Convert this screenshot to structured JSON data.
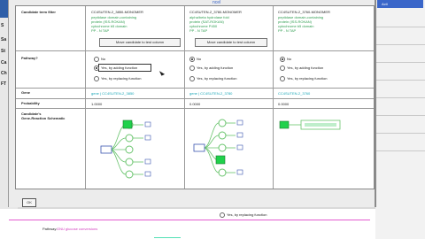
{
  "left_strip": [
    "S",
    "Sa",
    "St",
    "Ca",
    "Ch",
    "FT"
  ],
  "right_pane": {
    "header": "Acti"
  },
  "window": {
    "title_fragment": "ncel",
    "rows": {
      "filter_header": "Candidate term filter",
      "pathway_header": "Pathway?",
      "gene_header": "Gene",
      "probability_header": "Probability",
      "schematic_header_1": "Candidate's",
      "schematic_header_2": "Gene-Reaction Schematic"
    },
    "columns": [
      {
        "monomer": "CC4SUTEN-2_3850-MONOMER",
        "desc": [
          "peptidase domain-containing",
          "protein (ISS-ROKAN)",
          "cytochrome b5 domain",
          "PP - N TAP"
        ],
        "move_button": "Move candidate to test column",
        "radio": [
          "No",
          "Yes, by adding function",
          "Yes, by replacing function"
        ],
        "selected": 1,
        "gene": "gene | CC4SUTEN-2_3850",
        "probability": "1.0000"
      },
      {
        "monomer": "CC4SUTEN-2_3780-MONOMER",
        "desc": [
          "alpha/beta hydrolase fold",
          "protein (SAT-ROKAN)",
          "cytochrome P450",
          "PP - N TAP"
        ],
        "move_button": "Move candidate to test column",
        "radio": [
          "No",
          "Yes, by adding function",
          "Yes, by replacing function"
        ],
        "selected": 0,
        "gene": "gene | CC4SUTEN-2_3780",
        "probability": "0.0000"
      },
      {
        "monomer": "CC4SUTEN-2_3760-MONOMER",
        "desc": [
          "peptidase domain-containing",
          "protein (ISS-ROKAN)",
          "cytochrome b5 domain",
          "PP - N TAP"
        ],
        "move_button": "",
        "radio": [
          "No",
          "Yes, by adding function",
          "Yes, by replacing function"
        ],
        "selected": 0,
        "gene": "CC4SUTEN-2_3760",
        "probability": "0.0000"
      }
    ],
    "ok_label": "OK"
  },
  "background": {
    "radio_label": "Yes, by replacing function",
    "pathway_prefix": "Pathway:",
    "pathway_link": "GNU glucose conversions"
  },
  "colors": {
    "link_cyan": "#1aa6b7",
    "green_text": "#2e9d4f",
    "schematic_green": "#1fd14b",
    "title_blue": "#3a66c9"
  }
}
